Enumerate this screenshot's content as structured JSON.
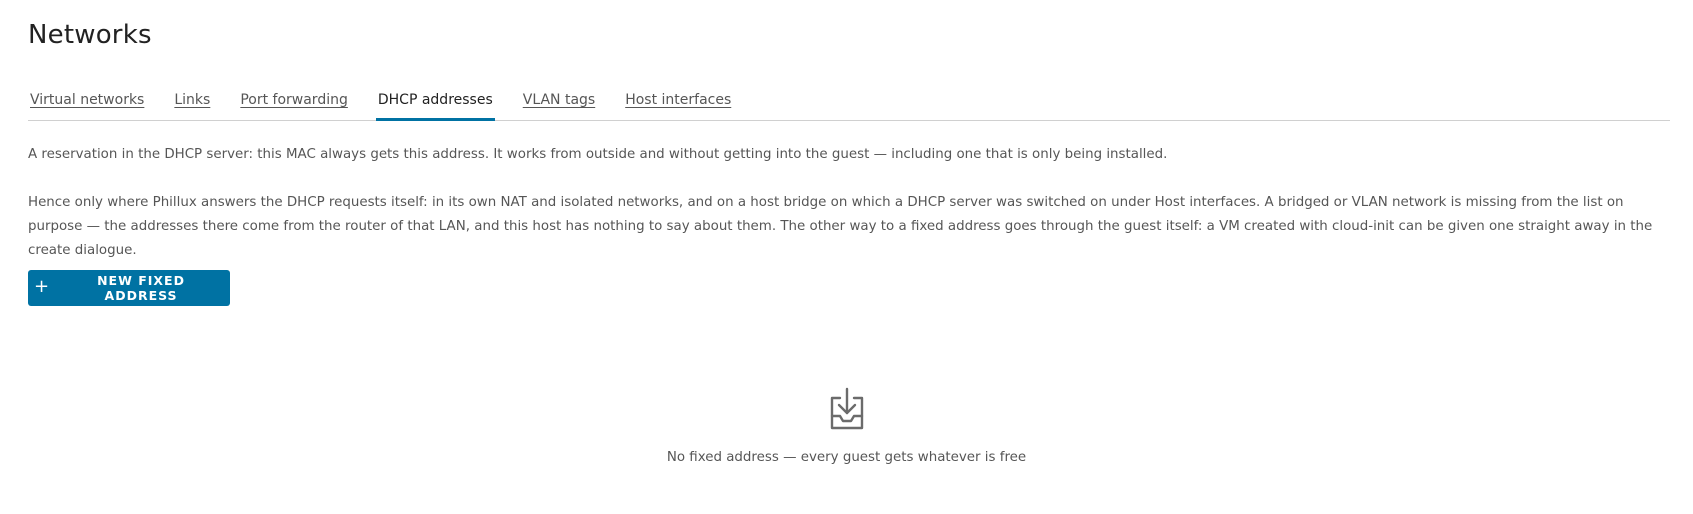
{
  "page": {
    "title": "Networks"
  },
  "tabs": [
    {
      "label": "Virtual networks",
      "active": false
    },
    {
      "label": "Links",
      "active": false
    },
    {
      "label": "Port forwarding",
      "active": false
    },
    {
      "label": "DHCP addresses",
      "active": true
    },
    {
      "label": "VLAN tags",
      "active": false
    },
    {
      "label": "Host interfaces",
      "active": false
    }
  ],
  "description": {
    "paragraph_1": "A reservation in the DHCP server: this MAC always gets this address. It works from outside and without getting into the guest — including one that is only being installed.",
    "paragraph_2": "Hence only where Phillux answers the DHCP requests itself: in its own NAT and isolated networks, and on a host bridge on which a DHCP server was switched on under Host interfaces. A bridged or VLAN network is missing from the list on purpose — the addresses there come from the router of that LAN, and this host has nothing to say about them. The other way to a fixed address goes through the guest itself: a VM created with cloud-init can be given one straight away in the create dialogue."
  },
  "actions": {
    "new_button_label": "NEW FIXED ADDRESS",
    "new_button_icon": "plus-icon"
  },
  "empty_state": {
    "icon": "inbox-download-icon",
    "text": "No fixed address — every guest gets whatever is free"
  },
  "colors": {
    "accent": "#0072a3",
    "text": "#565656",
    "title": "#222222",
    "divider": "#d0d0d0"
  }
}
